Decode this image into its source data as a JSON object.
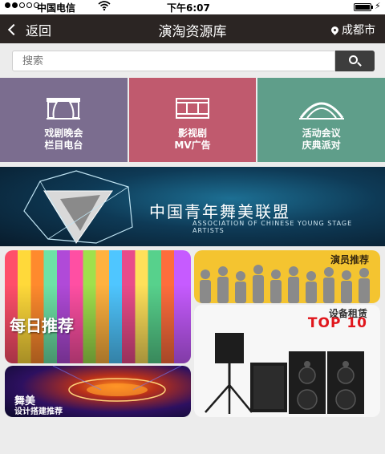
{
  "status_bar": {
    "carrier": "中国电信",
    "time": "下午6:07",
    "signal_bars_filled": 2,
    "signal_bars_total": 5,
    "battery_level": 0.9
  },
  "nav": {
    "back_label": "返回",
    "title": "演淘资源库",
    "city": "成都市"
  },
  "search": {
    "placeholder": "搜索"
  },
  "categories": [
    {
      "line1": "戏剧晚会",
      "line2": "栏目电台",
      "color": "#7b6d8f",
      "icon": "stage-curtain-icon"
    },
    {
      "line1": "影视剧",
      "line2": "MV广告",
      "color": "#c05a6e",
      "icon": "film-strip-icon"
    },
    {
      "line1": "活动会议",
      "line2": "庆典派对",
      "color": "#5f9e8a",
      "icon": "arch-icon"
    }
  ],
  "banner": {
    "logo_text": "中国青年舞美联盟",
    "sub_text": "ASSOCIATION OF CHINESE YOUNG STAGE ARTISTS"
  },
  "cards": {
    "daily": "每日推荐",
    "stage_line1": "舞美",
    "stage_line2": "设计搭建推荐",
    "actor": "演员推荐",
    "rent": "设备租赁",
    "rent_badge": "TOP 10"
  }
}
